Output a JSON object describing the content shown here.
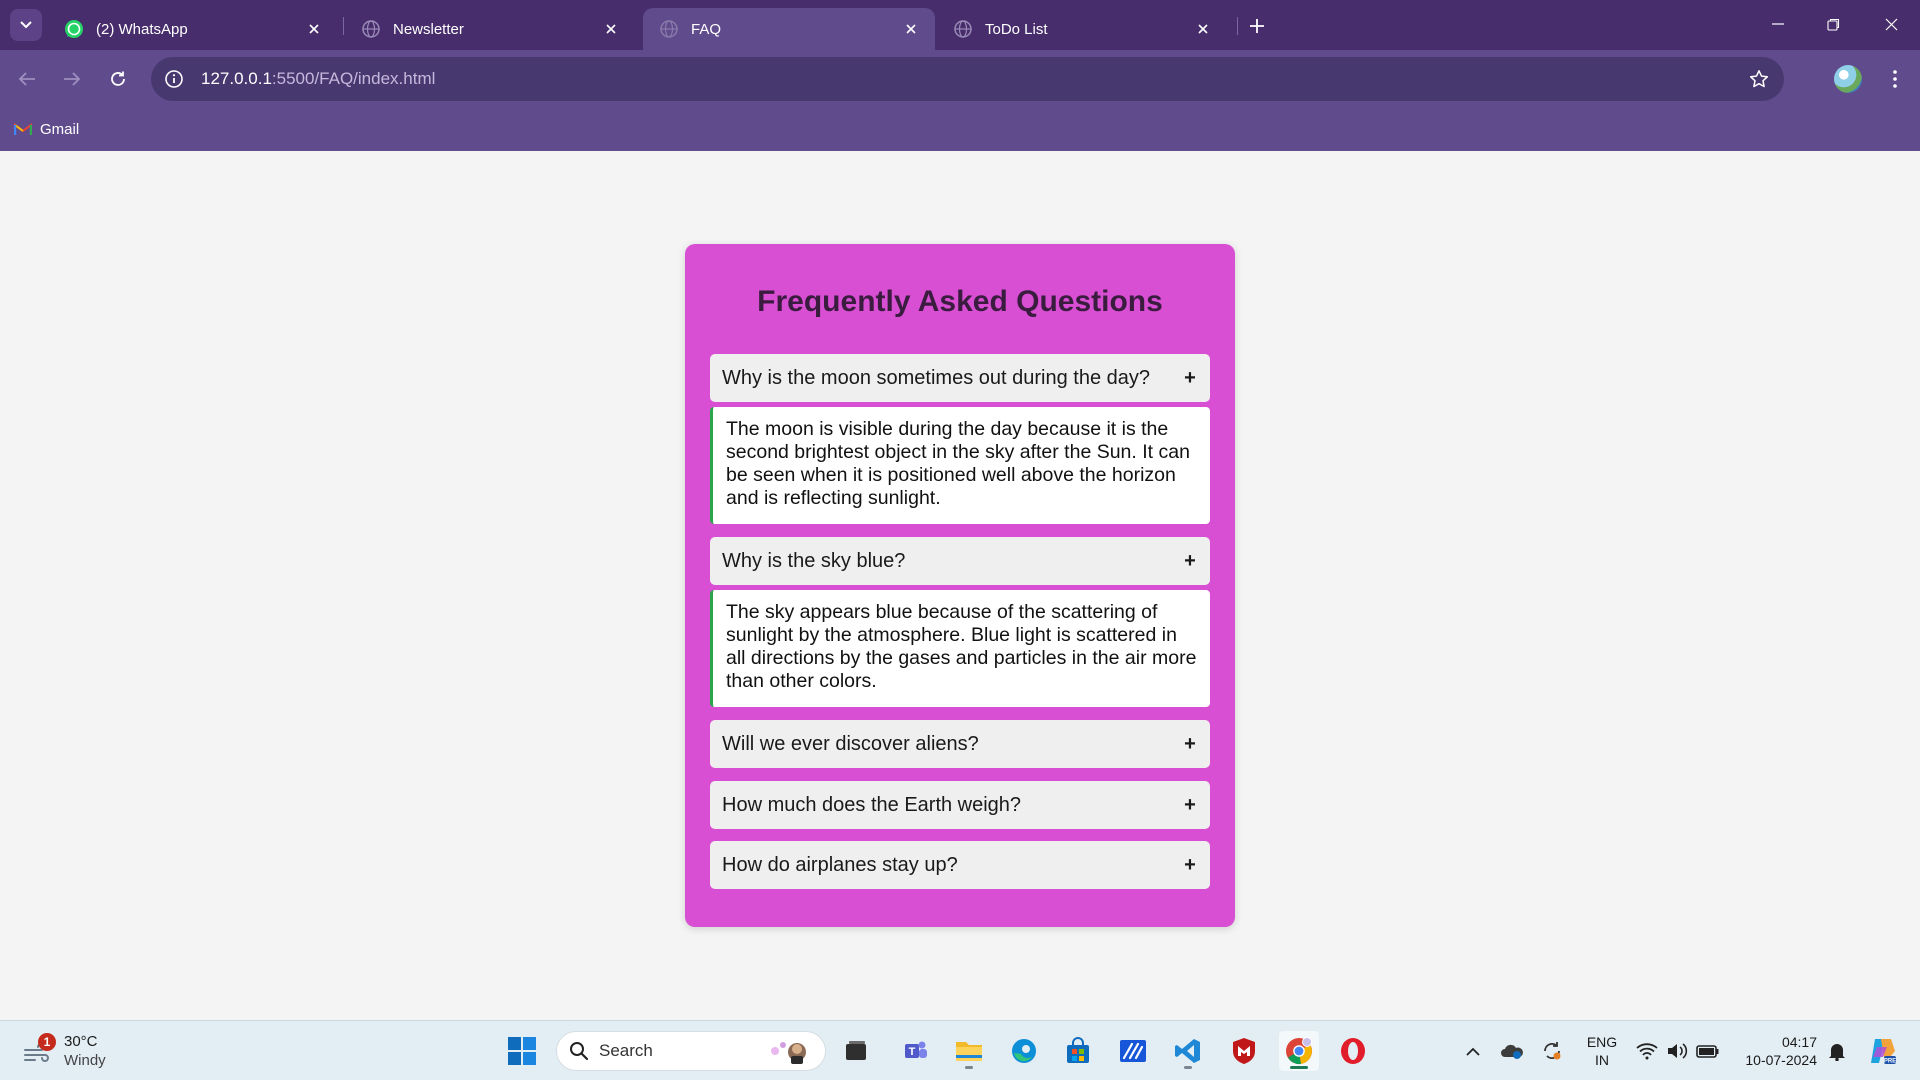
{
  "browser": {
    "tabs": [
      {
        "title": "(2) WhatsApp",
        "icon": "whatsapp-icon",
        "active": false
      },
      {
        "title": "Newsletter",
        "icon": "globe-icon",
        "active": false
      },
      {
        "title": "FAQ",
        "icon": "globe-icon",
        "active": true
      },
      {
        "title": "ToDo List",
        "icon": "globe-icon",
        "active": false
      }
    ],
    "url_host": "127.0.0.1",
    "url_rest": ":5500/FAQ/index.html",
    "bookmarks": [
      {
        "label": "Gmail",
        "icon": "gmail-icon"
      }
    ]
  },
  "faq": {
    "title": "Frequently Asked Questions",
    "items": [
      {
        "question": "Why is the moon sometimes out during the day?",
        "toggle": "+",
        "answer": "The moon is visible during the day because it is the second brightest object in the sky after the Sun. It can be seen when it is positioned well above the horizon and is reflecting sunlight.",
        "expanded": true
      },
      {
        "question": "Why is the sky blue?",
        "toggle": "+",
        "answer": "The sky appears blue because of the scattering of sunlight by the atmosphere. Blue light is scattered in all directions by the gases and particles in the air more than other colors.",
        "expanded": true
      },
      {
        "question": "Will we ever discover aliens?",
        "toggle": "+",
        "expanded": false
      },
      {
        "question": "How much does the Earth weigh?",
        "toggle": "+",
        "expanded": false
      },
      {
        "question": "How do airplanes stay up?",
        "toggle": "+",
        "expanded": false
      }
    ]
  },
  "taskbar": {
    "weather": {
      "temperature": "30°C",
      "condition": "Windy",
      "badge": "1"
    },
    "search_placeholder": "Search",
    "pinned_apps": [
      "windows-start-icon",
      "task-view-icon",
      "teams-icon",
      "file-explorer-icon",
      "edge-icon",
      "store-icon",
      "mail-icon",
      "vscode-icon",
      "mcafee-icon",
      "chrome-icon",
      "opera-icon"
    ],
    "language": {
      "line1": "ENG",
      "line2": "IN"
    },
    "time": "04:17",
    "date": "10-07-2024"
  },
  "colors": {
    "tabstrip": "#472d6b",
    "toolbar": "#604b8d",
    "faq_card": "#d84fd4",
    "faq_title": "#3a1c3f",
    "answer_border": "#2aa64a",
    "page_bg": "#f4f4f4"
  }
}
